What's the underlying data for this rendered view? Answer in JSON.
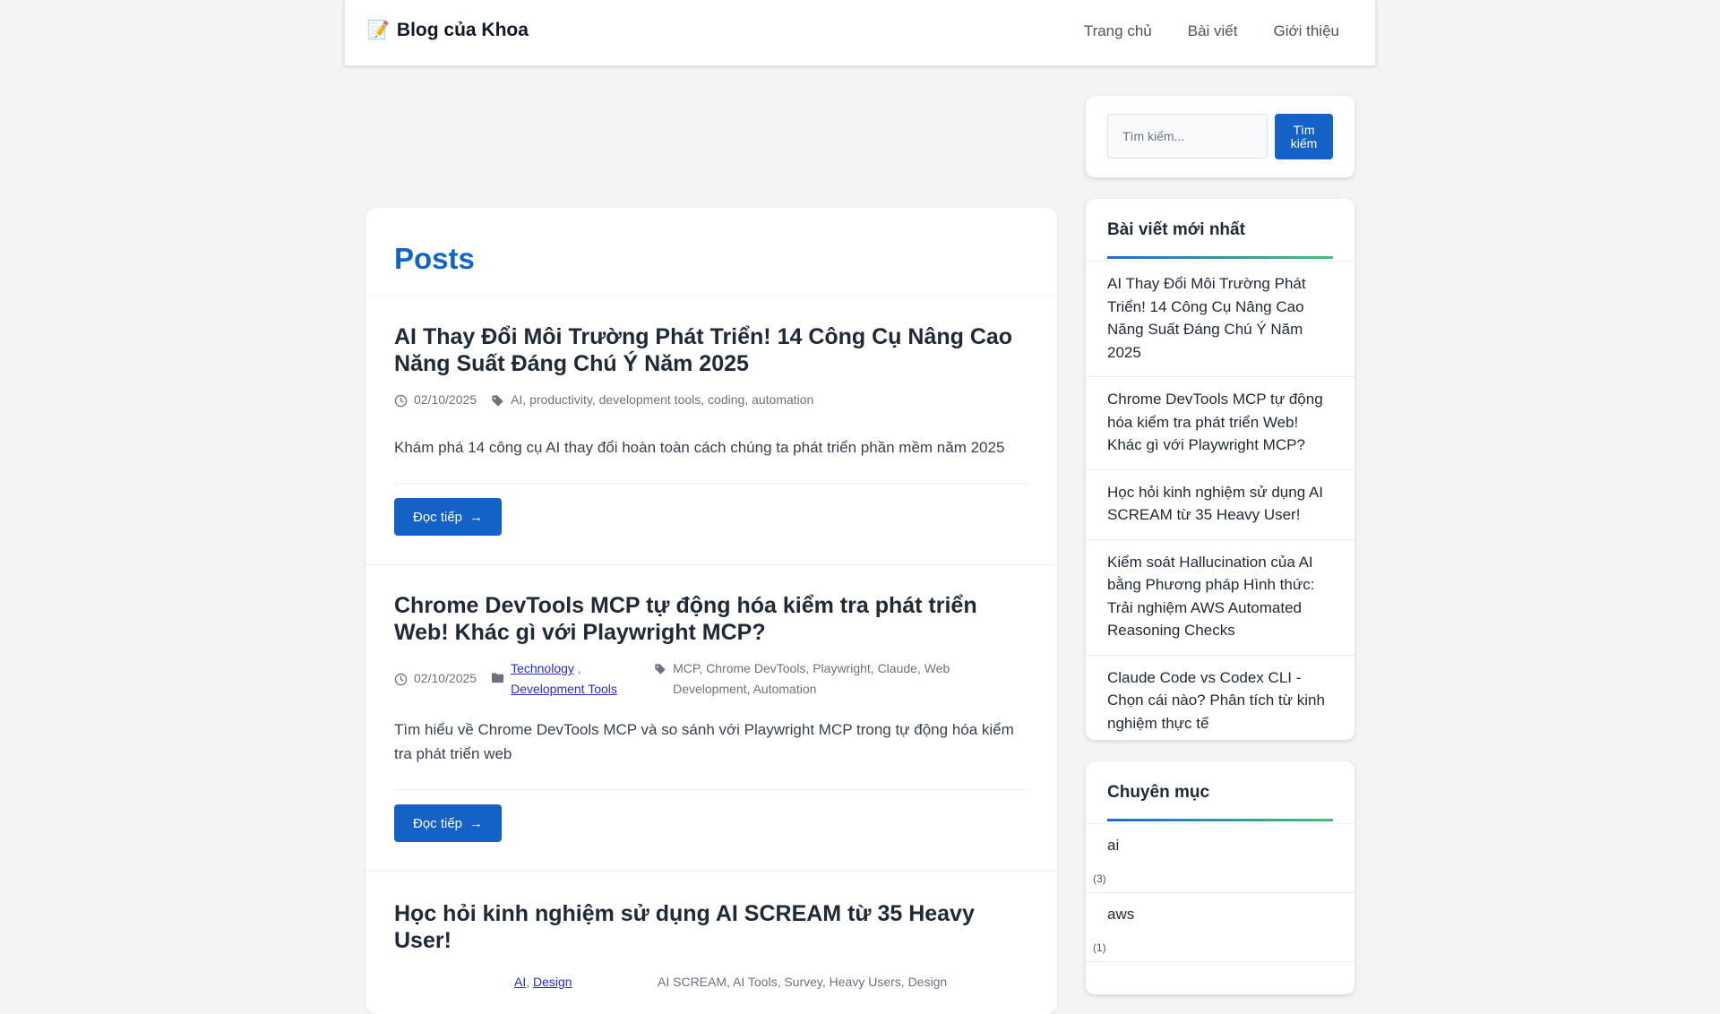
{
  "header": {
    "brand_icon": "📝",
    "brand": "Blog của Khoa",
    "nav": [
      "Trang chủ",
      "Bài viết",
      "Giới thiệu"
    ]
  },
  "main": {
    "title": "Posts",
    "read_more_label": "Đọc tiếp",
    "posts": [
      {
        "title": "AI Thay Đổi Môi Trường Phát Triển! 14 Công Cụ Nâng Cao Năng Suất Đáng Chú Ý Năm 2025",
        "date": "02/10/2025",
        "tags": "AI, productivity, development tools, coding, automation",
        "excerpt": "Khám phá 14 công cụ AI thay đổi hoàn toàn cách chúng ta phát triển phần mềm năm 2025"
      },
      {
        "title": "Chrome DevTools MCP tự động hóa kiểm tra phát triển Web! Khác gì với Playwright MCP?",
        "date": "02/10/2025",
        "categories": [
          "Technology",
          "Development Tools"
        ],
        "tags": "MCP, Chrome DevTools, Playwright, Claude, Web Development, Automation",
        "excerpt": "Tìm hiểu về Chrome DevTools MCP và so sánh với Playwright MCP trong tự động hóa kiểm tra phát triển web"
      },
      {
        "title": "Học hỏi kinh nghiệm sử dụng AI SCREAM từ 35 Heavy User!",
        "categories": [
          "AI",
          "Design"
        ],
        "tags": "AI SCREAM, AI Tools, Survey, Heavy Users, Design"
      }
    ]
  },
  "sidebar": {
    "search_placeholder": "Tìm kiếm...",
    "search_button": "Tìm kiếm",
    "recent_title": "Bài viết mới nhất",
    "recent": [
      "AI Thay Đổi Môi Trường Phát Triển! 14 Công Cụ Nâng Cao Năng Suất Đáng Chú Ý Năm 2025",
      "Chrome DevTools MCP tự động hóa kiểm tra phát triển Web! Khác gì với Playwright MCP?",
      "Học hỏi kinh nghiệm sử dụng AI SCREAM từ 35 Heavy User!",
      "Kiểm soát Hallucination của AI bằng Phương pháp Hình thức: Trải nghiệm AWS Automated Reasoning Checks",
      "Claude Code vs Codex CLI - Chọn cái nào? Phân tích từ kinh nghiệm thực tế"
    ],
    "categories_title": "Chuyên mục",
    "categories": [
      {
        "name": "ai",
        "count": "(3)"
      },
      {
        "name": "aws",
        "count": "(1)"
      }
    ]
  },
  "colors": {
    "accent": "#1462c8",
    "title_blue": "#1166c5",
    "link": "#2a2ad6"
  }
}
